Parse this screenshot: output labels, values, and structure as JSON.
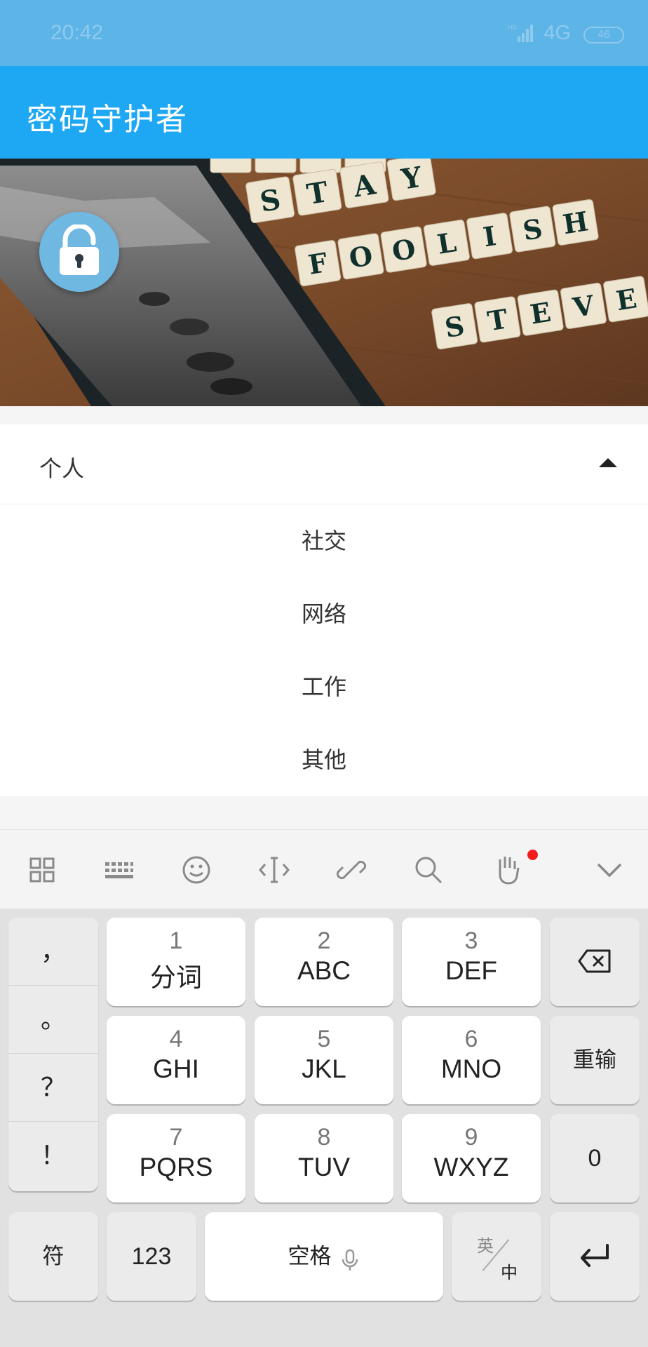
{
  "status_bar": {
    "time": "20:42",
    "network": "4G",
    "battery": "46"
  },
  "app_bar": {
    "title": "密码守护者"
  },
  "hero": {
    "image_words": [
      "STAY",
      "FOOLISH",
      "STEVE"
    ],
    "lock_icon": "lock-open-icon"
  },
  "category_select": {
    "selected": "个人",
    "options": [
      "社交",
      "网络",
      "工作",
      "其他"
    ]
  },
  "keyboard_toolbar": {
    "icons": [
      "grid-icon",
      "keyboard-icon",
      "emoji-icon",
      "cursor-icon",
      "link-icon",
      "search-icon",
      "hand-icon",
      "collapse-chevron-icon"
    ],
    "notification_color": "#f21b1b"
  },
  "keyboard": {
    "punctuation": [
      "，",
      "。",
      "？",
      "！"
    ],
    "keys": [
      {
        "num": "1",
        "letters": "分词"
      },
      {
        "num": "2",
        "letters": "ABC"
      },
      {
        "num": "3",
        "letters": "DEF"
      },
      {
        "num": "4",
        "letters": "GHI"
      },
      {
        "num": "5",
        "letters": "JKL"
      },
      {
        "num": "6",
        "letters": "MNO"
      },
      {
        "num": "7",
        "letters": "PQRS"
      },
      {
        "num": "8",
        "letters": "TUV"
      },
      {
        "num": "9",
        "letters": "WXYZ"
      }
    ],
    "reinput": "重输",
    "zero": "0",
    "symbol": "符",
    "numbers": "123",
    "space": "空格",
    "lang_en": "英",
    "lang_zh": "中"
  },
  "colors": {
    "status_bar": "#5db4e7",
    "app_bar": "#1ea7f3",
    "lock_fab": "#6fb8e2"
  }
}
